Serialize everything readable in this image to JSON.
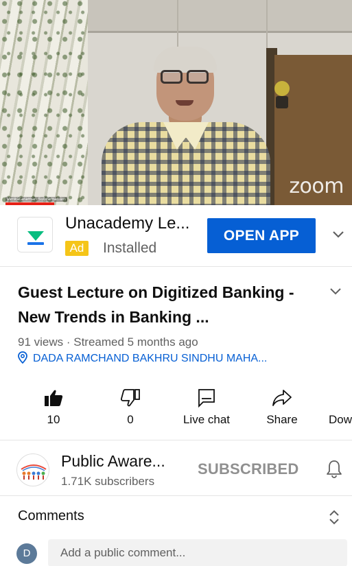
{
  "video": {
    "presenter_name": "Venkataraman Subramanian",
    "watermark": "zoom",
    "progress_fraction": 0.14
  },
  "ad": {
    "app_name": "Unacademy Le...",
    "badge": "Ad",
    "status": "Installed",
    "cta": "OPEN APP",
    "icon": "unacademy-logo-icon"
  },
  "video_info": {
    "title": "Guest Lecture on Digitized Banking - New Trends in Banking ...",
    "meta": "91 views · Streamed 5 months ago",
    "location": "DADA RAMCHAND BAKHRU SINDHU MAHA..."
  },
  "actions": [
    {
      "label": "10",
      "icon": "thumbs-up-filled-icon"
    },
    {
      "label": "0",
      "icon": "thumbs-down-icon"
    },
    {
      "label": "Live chat",
      "icon": "live-chat-icon"
    },
    {
      "label": "Share",
      "icon": "share-icon"
    },
    {
      "label": "Dow",
      "icon": "download-icon"
    }
  ],
  "channel": {
    "name": "Public Aware...",
    "subscribers": "1.71K subscribers",
    "subscribe_state": "SUBSCRIBED"
  },
  "comments": {
    "title": "Comments",
    "user_initial": "D",
    "placeholder": "Add a public comment..."
  },
  "colors": {
    "accent": "#065fd4",
    "ad_badge": "#f5c518",
    "progress": "#e62117",
    "secondary_text": "#606060"
  }
}
